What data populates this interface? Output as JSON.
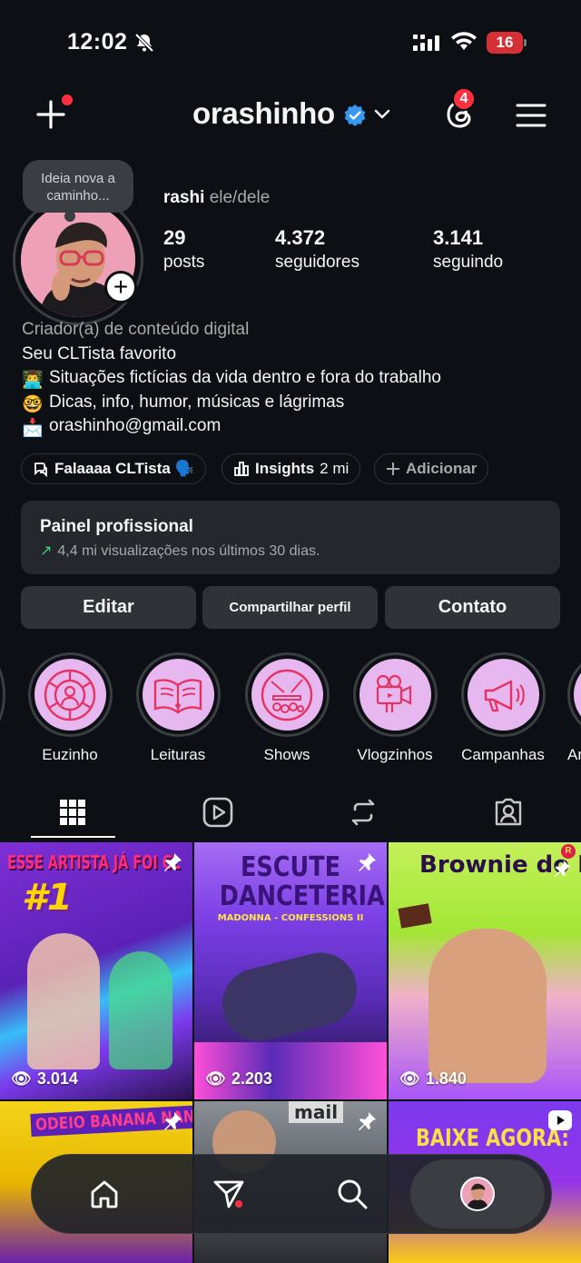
{
  "status": {
    "time": "12:02",
    "battery": "16"
  },
  "header": {
    "username": "orashinho",
    "threads_badge": "4"
  },
  "profile": {
    "note": "Ideia nova a caminho...",
    "name": "rashi",
    "pronouns": "ele/dele",
    "stats": [
      {
        "value": "29",
        "label": "posts"
      },
      {
        "value": "4.372",
        "label": "seguidores"
      },
      {
        "value": "3.141",
        "label": "seguindo"
      }
    ],
    "category": "Criador(a) de conteúdo digital",
    "bio": [
      {
        "emoji": "",
        "text": "Seu CLTista favorito"
      },
      {
        "emoji": "👨‍💻",
        "text": "Situações fictícias da vida dentro e fora do trabalho"
      },
      {
        "emoji": "🤓",
        "text": "Dicas, info, humor, músicas e lágrimas"
      },
      {
        "emoji": "📩",
        "text": "orashinho@gmail.com"
      }
    ]
  },
  "chips": {
    "channel": "Falaaaa CLTista 🗣️",
    "insights": "Insights",
    "insights_count": "2 mi",
    "add": "Adicionar"
  },
  "panel": {
    "title": "Painel profissional",
    "subtitle": "4,4 mi visualizações nos últimos 30 dias."
  },
  "buttons": {
    "edit": "Editar",
    "share": "Compartilhar perfil",
    "contact": "Contato"
  },
  "highlights": [
    "Euzinho",
    "Leituras",
    "Shows",
    "Vlogzinhos",
    "Campanhas",
    "Ar"
  ],
  "grid": [
    {
      "headline": "ESSE ARTISTA JÁ FOI CL",
      "sub": "#1",
      "views": "3.014"
    },
    {
      "headline": "ESCUTE DANCETERIA",
      "sub": "MADONNA - CONFESSIONS II",
      "views": "2.203"
    },
    {
      "headline": "Brownie do Rashi",
      "sub": "",
      "views": "1.840"
    },
    {
      "headline": "ODEIO BANANA NANICA",
      "sub": "",
      "views": ""
    },
    {
      "headline": "mail",
      "sub": "",
      "views": ""
    },
    {
      "headline": "BAIXE AGORA:",
      "sub": "",
      "views": ""
    }
  ]
}
